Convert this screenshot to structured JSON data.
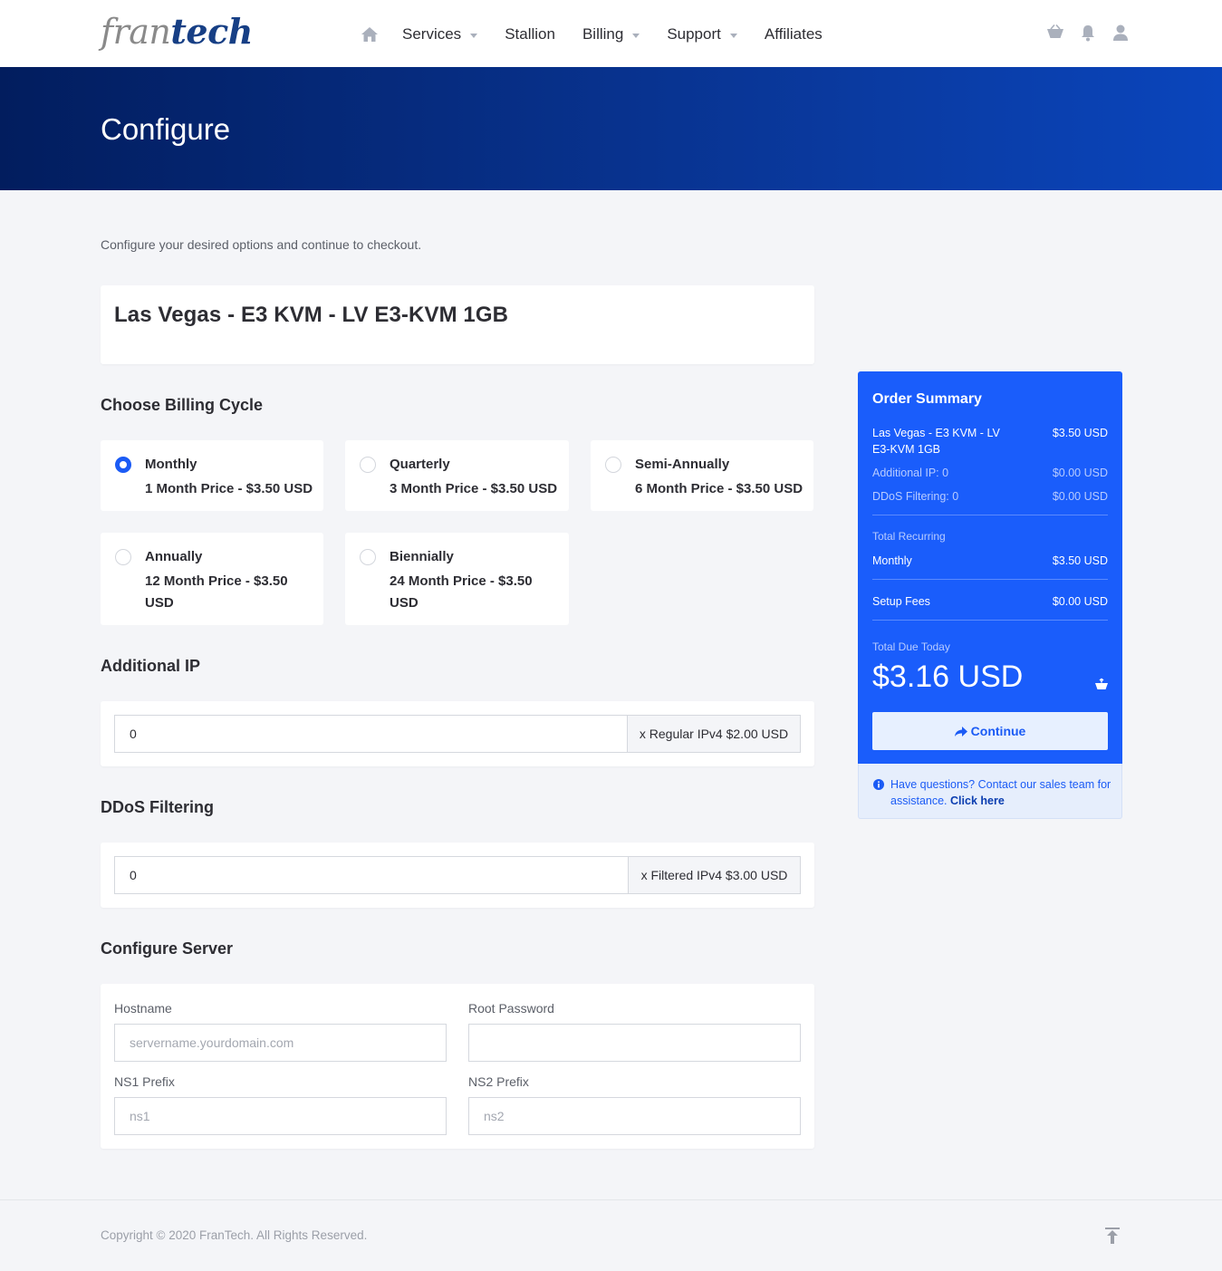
{
  "logo": {
    "part1": "fran",
    "part2": "tech"
  },
  "nav": {
    "items": [
      {
        "label": "Services",
        "dropdown": true
      },
      {
        "label": "Stallion",
        "dropdown": false
      },
      {
        "label": "Billing",
        "dropdown": true
      },
      {
        "label": "Support",
        "dropdown": true
      },
      {
        "label": "Affiliates",
        "dropdown": false
      }
    ],
    "icons": [
      "home-icon",
      "cart-icon",
      "bell-icon",
      "user-icon"
    ]
  },
  "banner": {
    "title": "Configure"
  },
  "intro": "Configure your desired options and continue to checkout.",
  "product": {
    "name": "Las Vegas - E3 KVM - LV E3-KVM 1GB"
  },
  "billing": {
    "title": "Choose Billing Cycle",
    "options": [
      {
        "title": "Monthly",
        "price": "1 Month Price - $3.50 USD",
        "selected": true
      },
      {
        "title": "Quarterly",
        "price": "3 Month Price - $3.50 USD",
        "selected": false
      },
      {
        "title": "Semi-Annually",
        "price": "6 Month Price - $3.50 USD",
        "selected": false
      },
      {
        "title": "Annually",
        "price": "12 Month Price - $3.50 USD",
        "selected": false
      },
      {
        "title": "Biennially",
        "price": "24 Month Price - $3.50 USD",
        "selected": false
      }
    ]
  },
  "additional_ip": {
    "title": "Additional IP",
    "value": "0",
    "addon": "x Regular IPv4 $2.00 USD"
  },
  "ddos": {
    "title": "DDoS Filtering",
    "value": "0",
    "addon": "x Filtered IPv4 $3.00 USD"
  },
  "server": {
    "title": "Configure Server",
    "hostname_label": "Hostname",
    "hostname_placeholder": "servername.yourdomain.com",
    "root_label": "Root Password",
    "root_placeholder": "",
    "ns1_label": "NS1 Prefix",
    "ns1_placeholder": "ns1",
    "ns2_label": "NS2 Prefix",
    "ns2_placeholder": "ns2"
  },
  "summary": {
    "title": "Order Summary",
    "product": "Las Vegas - E3 KVM - LV E3-KVM 1GB",
    "product_price": "$3.50 USD",
    "addl_ip_label": "Additional IP: 0",
    "addl_ip_price": "$0.00 USD",
    "ddos_label": "DDoS Filtering: 0",
    "ddos_price": "$0.00 USD",
    "recurring_label": "Total Recurring",
    "recurring_cycle": "Monthly",
    "recurring_price": "$3.50 USD",
    "setup_label": "Setup Fees",
    "setup_price": "$0.00 USD",
    "due_label": "Total Due Today",
    "due_total": "$3.16 USD",
    "continue_label": "Continue",
    "help_text": "Have questions? Contact our sales team for assistance.",
    "help_link": "Click here"
  },
  "footer": {
    "copyright": "Copyright © 2020 FranTech. All Rights Reserved."
  },
  "colors": {
    "accent": "#1a5dfb",
    "banner_dark": "#021d5e",
    "banner_light": "#0a45bc"
  }
}
